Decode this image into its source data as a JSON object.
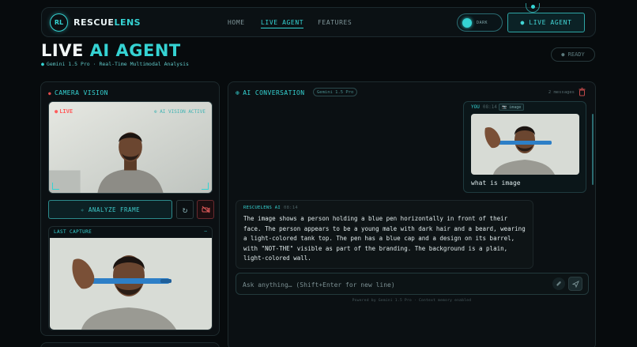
{
  "nav": {
    "logo_badge": "RL",
    "brand_main": "RESCUE",
    "brand_accent": "LENS",
    "links": [
      "HOME",
      "LIVE AGENT",
      "FEATURES"
    ],
    "theme_toggle_label": "DARK",
    "cta_label": "● LIVE AGENT"
  },
  "header": {
    "title_main": "LIVE",
    "title_accent": "AI AGENT",
    "subtitle": "Gemini 1.5 Pro · Real-Time Multimodal Analysis",
    "status_pill": "● READY"
  },
  "camera": {
    "title": "CAMERA VISION",
    "live_tag": "LIVE",
    "ai_tag": "⊕ AI VISION ACTIVE",
    "analyze_label": "✧ ANALYZE FRAME",
    "last_capture_title": "LAST CAPTURE",
    "last_capture_action": "–"
  },
  "chat": {
    "title": "AI CONVERSATION",
    "model_chip": "Gemini 1.5 Pro",
    "message_count": "2 messages",
    "user_message": {
      "sender": "YOU",
      "time": "08:14",
      "attachment_chip": "📷 image",
      "text": "what is image"
    },
    "ai_message": {
      "sender": "RESCUELENS AI",
      "time": "08:14",
      "text": "The image shows a person holding a blue pen horizontally in front of their face. The person appears to be a young male with dark hair and a beard, wearing a light-colored tank top. The pen has a blue cap and a design on its barrel, with \"NOT-THE\" visible as part of the branding. The background is a plain, light-colored wall."
    },
    "input_placeholder": "Ask anything… (Shift+Enter for new line)",
    "footer_note": "Powered by Gemini 1.5 Pro · Context memory enabled"
  },
  "colors": {
    "accent": "#35d3d3",
    "background": "#070b0d",
    "live_red": "#ff5c5c"
  },
  "icons": [
    "logo-badge-icon",
    "refresh-icon",
    "camera-off-icon",
    "trash-icon",
    "attach-icon",
    "send-icon"
  ]
}
